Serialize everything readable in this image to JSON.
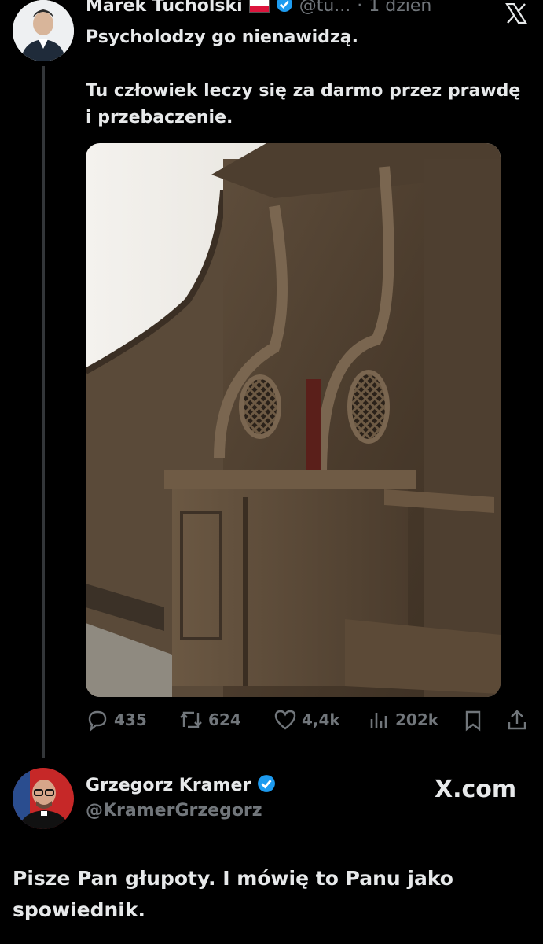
{
  "tweet": {
    "author_name": "Marek Tucholski",
    "handle_truncated": "@tu...",
    "separator": "·",
    "time": "1 dzień",
    "flag_icon": "poland-flag-icon",
    "verified_icon": "verified-badge-icon",
    "lines": [
      "Psycholodzy go nienawidzą.",
      "Tu człowiek leczy się za darmo przez prawdę",
      "i przebaczenie."
    ],
    "media_alt_icon": "photo-confessional",
    "actions": {
      "replies": "435",
      "retweets": "624",
      "likes": "4,4k",
      "views": "202k"
    }
  },
  "reply": {
    "author_name": "Grzegorz Kramer",
    "handle": "@KramerGrzegorz",
    "site": "X.com",
    "lines": [
      "Pisze Pan głupoty. I mówię to Panu jako",
      "spowiednik."
    ]
  },
  "colors": {
    "background": "#000000",
    "text": "#e7e9ea",
    "muted": "#71767b",
    "verified": "#1d9bf0"
  }
}
